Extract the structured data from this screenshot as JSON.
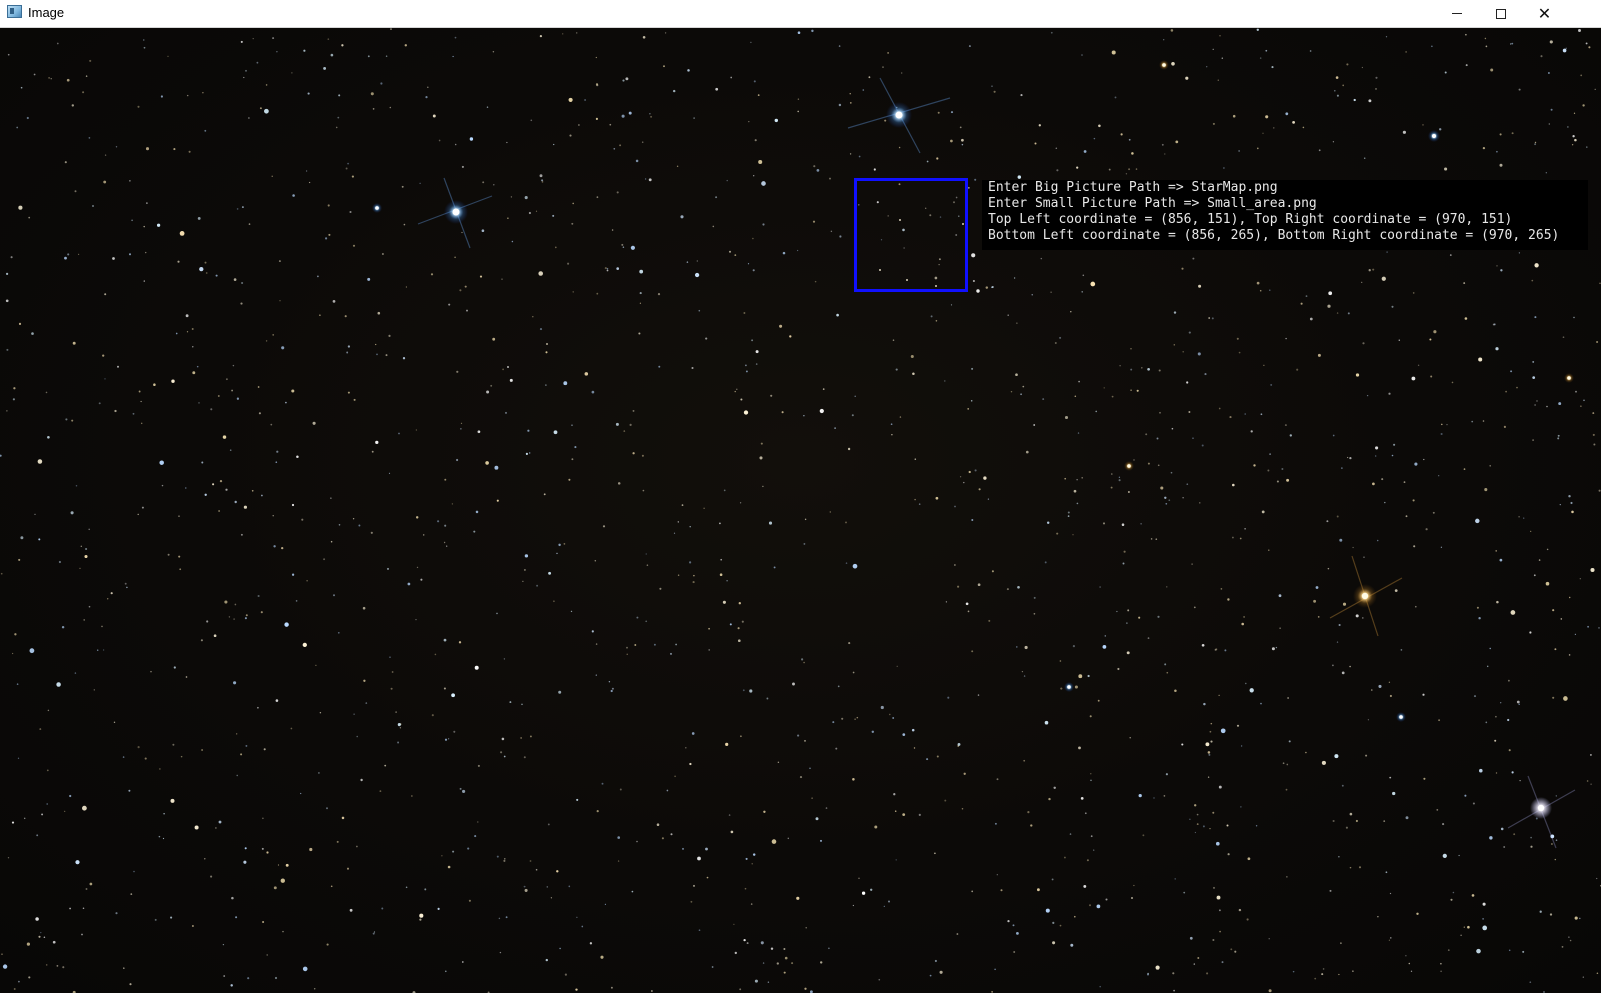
{
  "window": {
    "title": "Image",
    "controls": {
      "minimize": "minimize-icon",
      "maximize": "maximize-icon",
      "close": "close-icon"
    }
  },
  "console": {
    "lines": [
      "Enter Big Picture Path => StarMap.png",
      "Enter Small Picture Path => Small_area.png",
      "Top Left coordinate = (856, 151), Top Right coordinate = (970, 151)",
      "Bottom Left coordinate = (856, 265), Bottom Right coordinate = (970, 265)"
    ]
  },
  "colors": {
    "background": "#0b0907",
    "match_box": "#1010ff",
    "console_text": "#e8e8e8",
    "console_bg": "#000000"
  }
}
